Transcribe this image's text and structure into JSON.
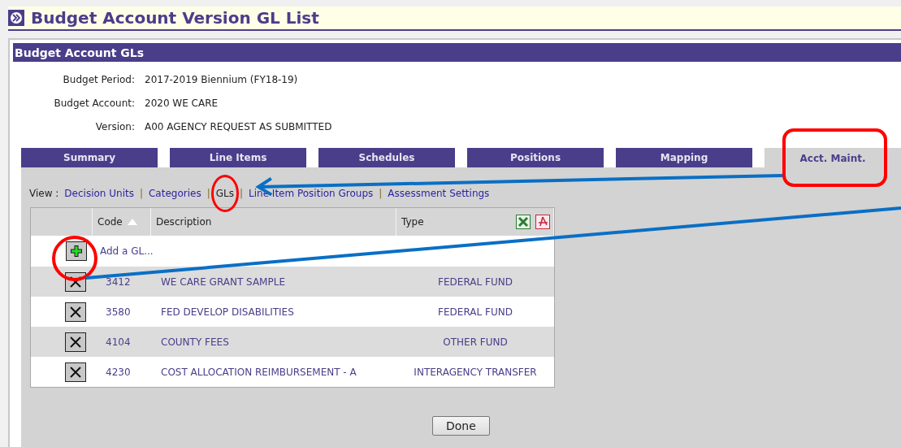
{
  "page_title": "Budget Account Version GL List",
  "panel": {
    "title": "Budget Account GLs",
    "fields": [
      {
        "label": "Budget Period:",
        "value": "2017-2019 Biennium (FY18-19)"
      },
      {
        "label": "Budget Account:",
        "value": "2020 WE CARE"
      },
      {
        "label": "Version:",
        "value": "A00 AGENCY REQUEST AS SUBMITTED"
      }
    ]
  },
  "tabs": [
    {
      "label": "Summary",
      "selected": false
    },
    {
      "label": "Line Items",
      "selected": false
    },
    {
      "label": "Schedules",
      "selected": false
    },
    {
      "label": "Positions",
      "selected": false
    },
    {
      "label": "Mapping",
      "selected": false
    },
    {
      "label": "Acct. Maint.",
      "selected": true
    }
  ],
  "view": {
    "label": "View :",
    "separator": "|",
    "items": [
      {
        "label": "Decision Units",
        "selected": false
      },
      {
        "label": "Categories",
        "selected": false
      },
      {
        "label": "GLs",
        "selected": true
      },
      {
        "label": "Line Item Position Groups",
        "selected": false
      },
      {
        "label": "Assessment Settings",
        "selected": false
      }
    ]
  },
  "table": {
    "columns": [
      "Code",
      "Description",
      "Type"
    ],
    "add_row": {
      "label": "Add a GL..."
    },
    "rows": [
      {
        "code": "3412",
        "description": "WE CARE GRANT SAMPLE",
        "type": "FEDERAL FUND"
      },
      {
        "code": "3580",
        "description": "FED DEVELOP DISABILITIES",
        "type": "FEDERAL FUND"
      },
      {
        "code": "4104",
        "description": "COUNTY FEES",
        "type": "OTHER FUND"
      },
      {
        "code": "4230",
        "description": "COST ALLOCATION REIMBURSEMENT - A",
        "type": "INTERAGENCY TRANSFER"
      }
    ]
  },
  "done_button": "Done"
}
